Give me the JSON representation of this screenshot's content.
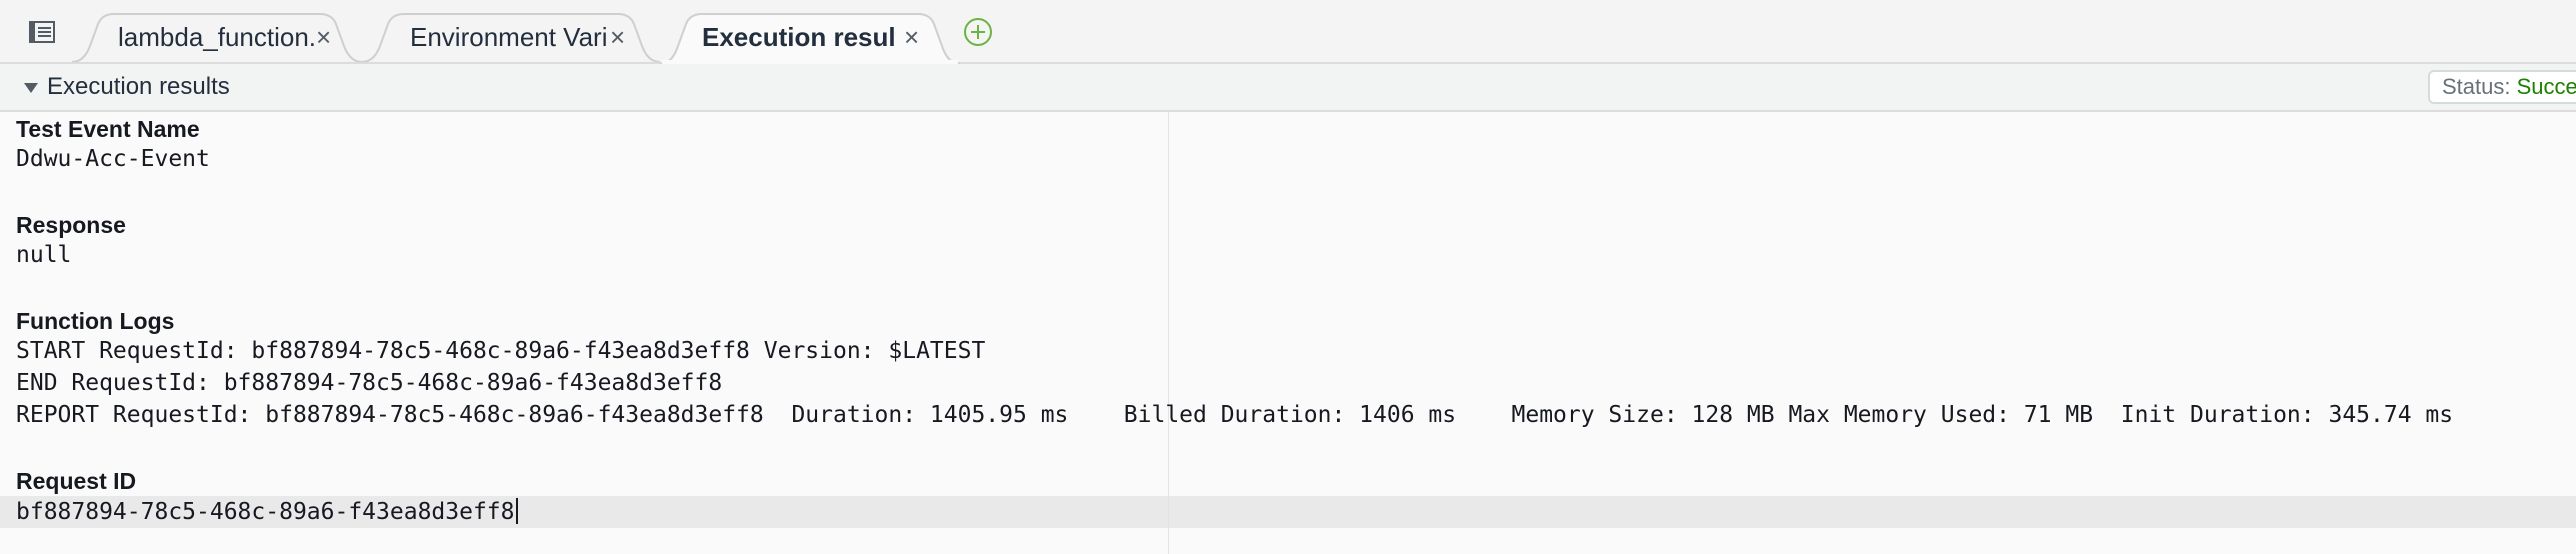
{
  "tabs": [
    {
      "label": "lambda_function.",
      "active": false
    },
    {
      "label": "Environment Vari",
      "active": false
    },
    {
      "label": "Execution results",
      "active": true
    }
  ],
  "icons": {
    "menu": "list-menu-icon",
    "close": "close-icon",
    "add": "plus-circle-icon",
    "collapse": "caret-down-icon"
  },
  "panel": {
    "title": "Execution results",
    "status_label": "Status: ",
    "status_value": "Succe"
  },
  "results": {
    "test_event": {
      "heading": "Test Event Name",
      "value": "Ddwu-Acc-Event"
    },
    "response": {
      "heading": "Response",
      "value": "null"
    },
    "function_logs": {
      "heading": "Function Logs",
      "lines": [
        "START RequestId: bf887894-78c5-468c-89a6-f43ea8d3eff8 Version: $LATEST",
        "END RequestId: bf887894-78c5-468c-89a6-f43ea8d3eff8",
        "REPORT RequestId: bf887894-78c5-468c-89a6-f43ea8d3eff8  Duration: 1405.95 ms    Billed Duration: 1406 ms    Memory Size: 128 MB Max Memory Used: 71 MB  Init Duration: 345.74 ms"
      ]
    },
    "request_id": {
      "heading": "Request ID",
      "value": "bf887894-78c5-468c-89a6-f43ea8d3eff8"
    }
  },
  "colors": {
    "accent_green": "#1d8102",
    "add_icon": "#6cb33f",
    "tab_bg": "#f4f4f4",
    "active_tab_bg": "#fafafa"
  }
}
